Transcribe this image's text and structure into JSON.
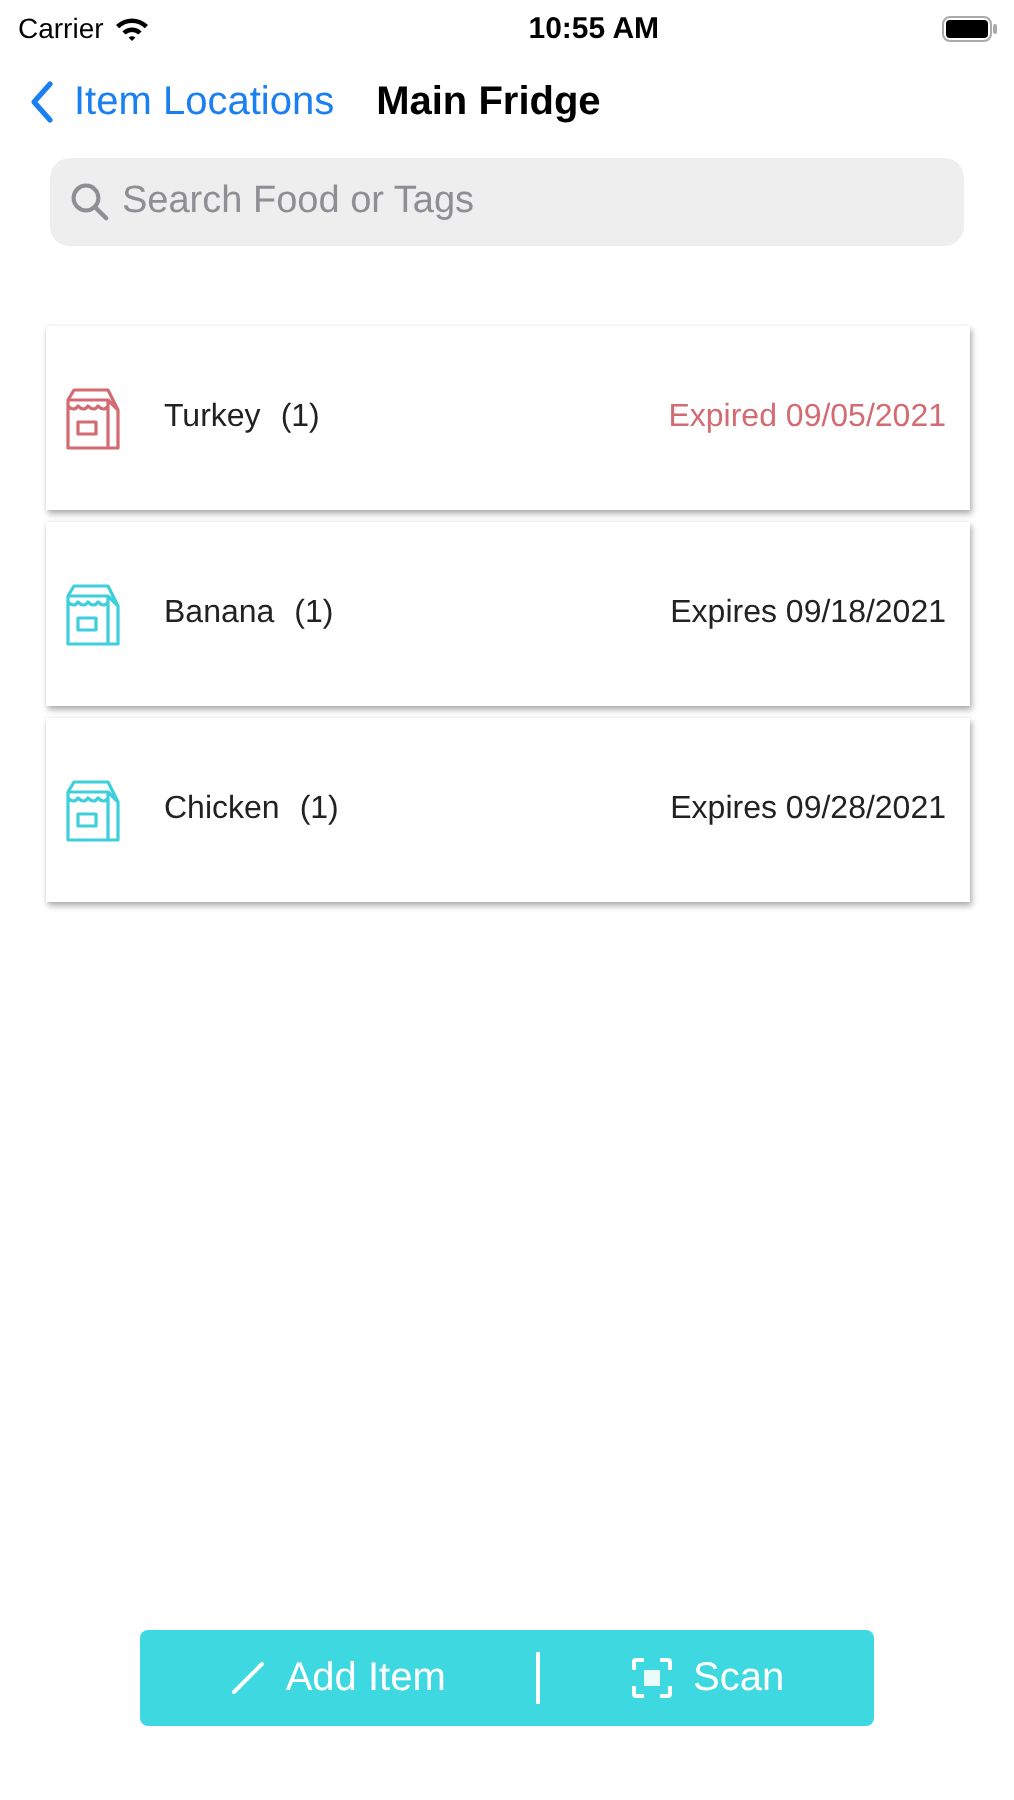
{
  "status_bar": {
    "carrier": "Carrier",
    "time": "10:55 AM"
  },
  "nav": {
    "back": "Item Locations",
    "title": "Main Fridge"
  },
  "search": {
    "placeholder": "Search Food or Tags"
  },
  "items": [
    {
      "name": "Turkey",
      "count": "(1)",
      "expiry": "Expired 09/05/2021",
      "expired": true
    },
    {
      "name": "Banana",
      "count": "(1)",
      "expiry": "Expires 09/18/2021",
      "expired": false
    },
    {
      "name": "Chicken",
      "count": "(1)",
      "expiry": "Expires 09/28/2021",
      "expired": false
    }
  ],
  "actions": {
    "add": "Add Item",
    "scan": "Scan"
  }
}
